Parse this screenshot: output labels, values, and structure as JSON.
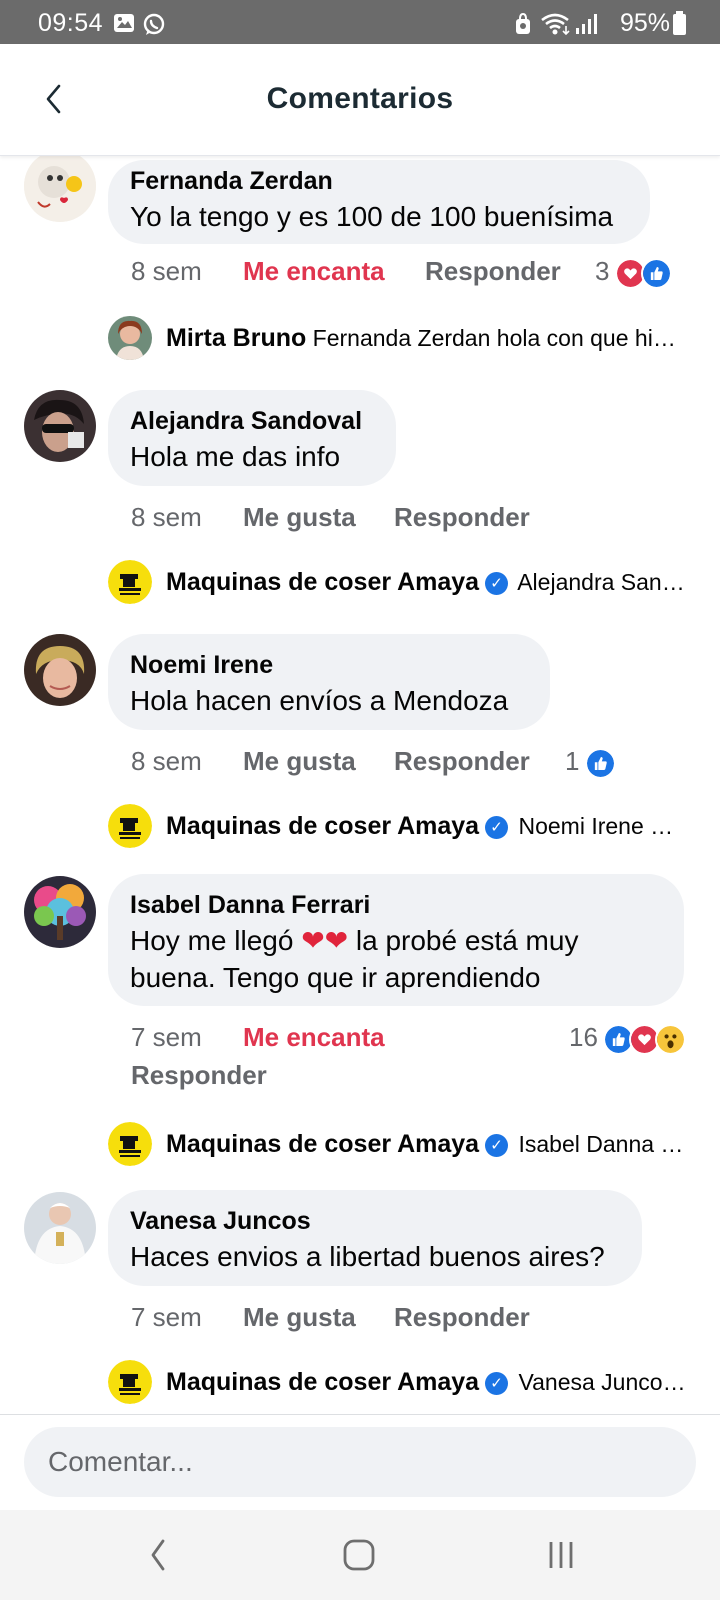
{
  "status_bar": {
    "time": "09:54",
    "battery": "95%"
  },
  "header": {
    "title": "Comentarios"
  },
  "colors": {
    "love": "#e0354f",
    "like": "#1b74e4",
    "bubble": "#f0f2f5",
    "meta": "#65676b"
  },
  "comments": [
    {
      "author": "Fernanda Zerdan",
      "text": "Yo la tengo y es 100 de 100 buenísima",
      "time": "8 sem",
      "reaction_label": "Me encanta",
      "reply_label": "Responder",
      "reaction_count": "3",
      "reply_preview": {
        "author": "Mirta Bruno",
        "text": "Fernanda Zerdan hola  con que  hice el pedido"
      }
    },
    {
      "author": "Alejandra Sandoval",
      "text": "Hola me das info",
      "time": "8 sem",
      "reaction_label": "Me gusta",
      "reply_label": "Responder",
      "reply_preview": {
        "author": "Maquinas de coser Amaya",
        "text": "Alejandra Sandoval hola"
      }
    },
    {
      "author": "Noemi Irene",
      "text": "Hola hacen envíos a Mendoza",
      "time": "8 sem",
      "reaction_label": "Me gusta",
      "reply_label": "Responder",
      "reaction_count": "1",
      "reply_preview": {
        "author": "Maquinas de coser Amaya",
        "text": "Noemi Irene Hola"
      }
    },
    {
      "author": "Isabel Danna Ferrari",
      "text_line1": "Hoy me llegó",
      "text_emoji": "❤❤",
      "text_line1b": "la probé está muy",
      "text_line2": "buena. Tengo que ir aprendiendo",
      "time": "7 sem",
      "reaction_label": "Me encanta",
      "reply_label": "Responder",
      "reaction_count": "16",
      "reply_preview": {
        "author": "Maquinas de coser Amaya",
        "text": "Isabel Danna Ferrari"
      }
    },
    {
      "author": "Vanesa Juncos",
      "text": "Haces envios a libertad buenos aires?",
      "time": "7 sem",
      "reaction_label": "Me gusta",
      "reply_label": "Responder",
      "reply_preview": {
        "author": "Maquinas de coser Amaya",
        "text": "Vanesa Juncos hola"
      }
    }
  ],
  "composer": {
    "placeholder": "Comentar..."
  },
  "icons": {
    "back": "chevron-left-icon",
    "like": "like-icon",
    "love": "love-icon",
    "wow": "wow-icon",
    "verified": "verified-badge-icon",
    "nav_back": "nav-back-icon",
    "nav_home": "nav-home-icon",
    "nav_recents": "nav-recents-icon"
  }
}
